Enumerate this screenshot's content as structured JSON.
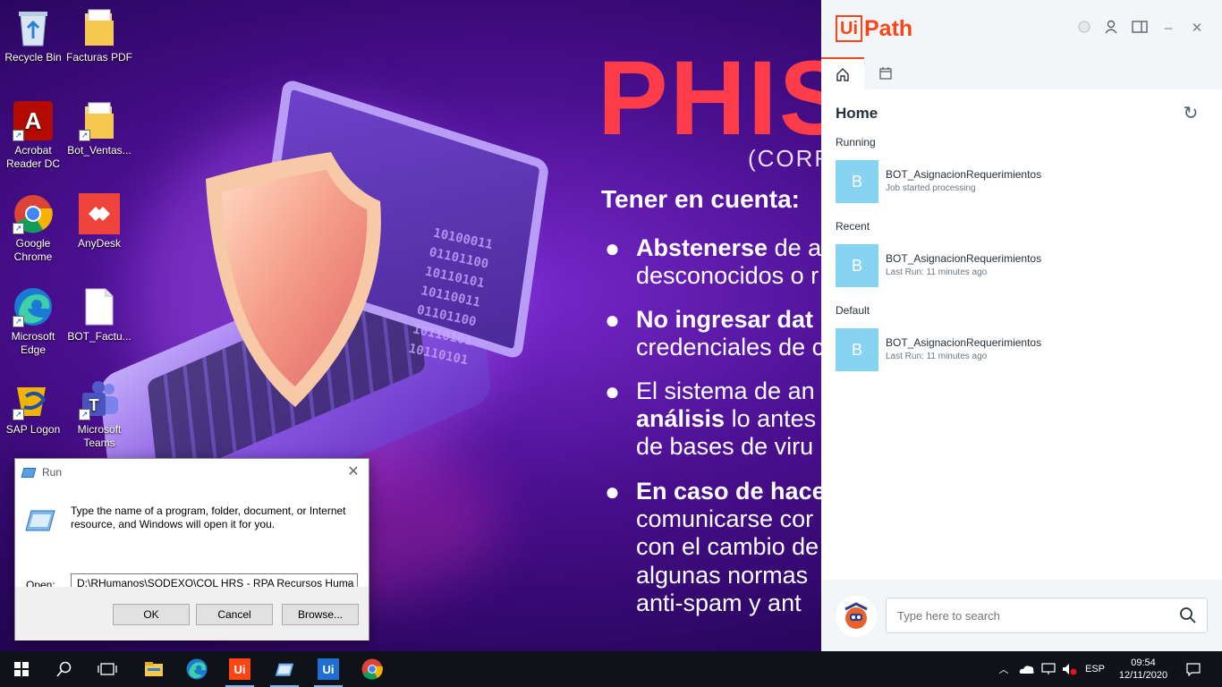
{
  "wallpaper": {
    "title": "PHIS",
    "subtitle": "(CORR",
    "heading": "Tener en cuenta:",
    "binary": "10100011\n01101100\n10110101\n10110011\n01101100\n10110101\n10110101",
    "lines": [
      {
        "bold": "Abstenerse",
        "text": " de a"
      },
      {
        "bold": "",
        "text": "desconocidos o r"
      },
      {
        "bold": "No ingresar dat",
        "text": ""
      },
      {
        "bold": "",
        "text": "credenciales de c"
      },
      {
        "bold": "",
        "text": "El sistema de an"
      },
      {
        "bold": "análisis",
        "text": " lo antes"
      },
      {
        "bold": "",
        "text": "de bases de viru"
      },
      {
        "bold": "En caso de hace",
        "text": ""
      },
      {
        "bold": "",
        "text": "comunicarse cor"
      },
      {
        "bold": "",
        "text": "con el cambio de"
      },
      {
        "bold": "",
        "text": "algunas normas"
      },
      {
        "bold": "",
        "text": "anti-spam y ant"
      }
    ]
  },
  "desktop_icons": [
    {
      "label": "Recycle Bin",
      "icon": "recycle-bin-icon"
    },
    {
      "label": "Facturas PDF",
      "icon": "folder-icon"
    },
    {
      "label": "Acrobat Reader DC",
      "icon": "acrobat-icon"
    },
    {
      "label": "Bot_Ventas...",
      "icon": "folder-icon"
    },
    {
      "label": "Google Chrome",
      "icon": "chrome-icon"
    },
    {
      "label": "AnyDesk",
      "icon": "anydesk-icon"
    },
    {
      "label": "Microsoft Edge",
      "icon": "edge-icon"
    },
    {
      "label": "BOT_Factu...",
      "icon": "file-icon"
    },
    {
      "label": "SAP Logon",
      "icon": "sap-icon"
    },
    {
      "label": "Microsoft Teams",
      "icon": "teams-icon"
    }
  ],
  "run_dialog": {
    "title": "Run",
    "description": "Type the name of a program, folder, document, or Internet resource, and Windows will open it for you.",
    "open_label": "Open:",
    "open_value": "D:\\RHumanos\\SODEXO\\COL HRS - RPA Recursos Huma",
    "ok": "OK",
    "cancel": "Cancel",
    "browse": "Browse..."
  },
  "uipath": {
    "logo_ui": "Ui",
    "logo_path": "Path",
    "title": "Home",
    "search_placeholder": "Type here to search",
    "sections": [
      {
        "label": "Running",
        "item": {
          "avatar": "B",
          "name": "BOT_AsignacionRequerimientos",
          "status": "Job started processing"
        }
      },
      {
        "label": "Recent",
        "item": {
          "avatar": "B",
          "name": "BOT_AsignacionRequerimientos",
          "status": "Last Run: 11 minutes ago"
        }
      },
      {
        "label": "Default",
        "item": {
          "avatar": "B",
          "name": "BOT_AsignacionRequerimientos",
          "status": "Last Run: 11 minutes ago"
        }
      }
    ],
    "accent": "#fa4616"
  },
  "taskbar": {
    "language": "ESP",
    "time": "09:54",
    "date": "12/11/2020",
    "apps": [
      "start-icon",
      "search-icon",
      "task-view-icon",
      "file-explorer-icon",
      "edge-icon",
      "uipath-assistant-icon",
      "run-icon",
      "uipath-studio-icon",
      "chrome-icon"
    ]
  }
}
